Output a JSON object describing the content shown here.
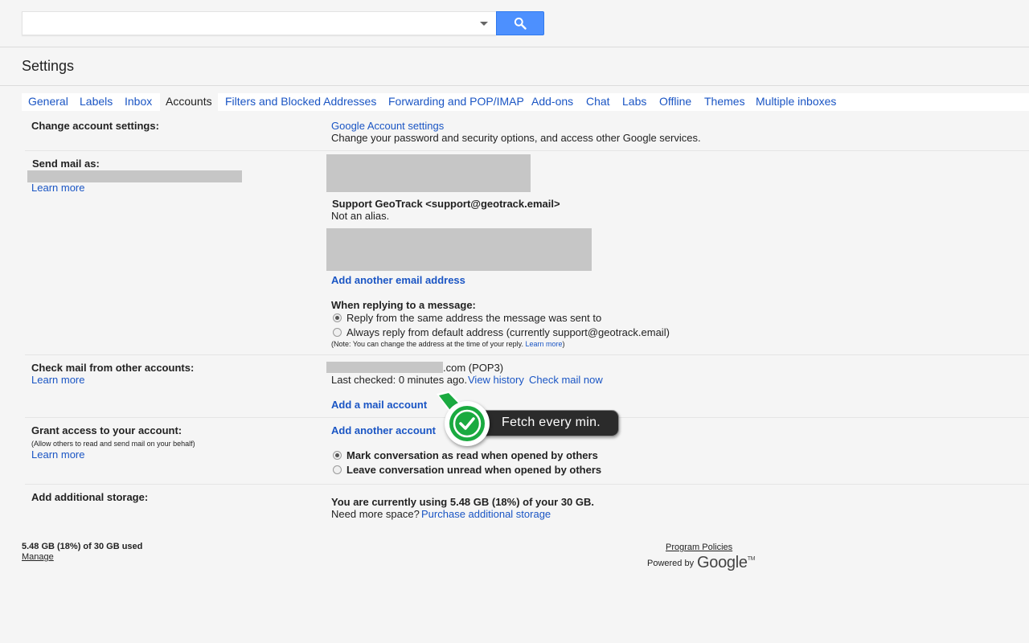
{
  "search": {
    "placeholder": "",
    "value": ""
  },
  "page_title": "Settings",
  "tabs": [
    {
      "label": "General"
    },
    {
      "label": "Labels"
    },
    {
      "label": "Inbox"
    },
    {
      "label": "Accounts"
    },
    {
      "label": "Filters and Blocked Addresses"
    },
    {
      "label": "Forwarding and POP/IMAP"
    },
    {
      "label": "Add-ons"
    },
    {
      "label": "Chat"
    },
    {
      "label": "Labs"
    },
    {
      "label": "Offline"
    },
    {
      "label": "Themes"
    },
    {
      "label": "Multiple inboxes"
    }
  ],
  "sections": {
    "change_account": {
      "label": "Change account settings:",
      "link": "Google Account settings",
      "description": "Change your password and security options, and access other Google services."
    },
    "send_mail": {
      "label": "Send mail as:",
      "learn_more": "Learn more",
      "account_name": "Support GeoTrack <support@geotrack.email>",
      "account_note": "Not an alias.",
      "add_address": "Add another email address",
      "reply_heading": "When replying to a message:",
      "reply_option_1": "Reply from the same address the message was sent to",
      "reply_option_2": "Always reply from default address (currently support@geotrack.email)",
      "reply_note": "(Note: You can change the address at the time of your reply.",
      "reply_note_link": "Learn more",
      "reply_note_end": ")"
    },
    "check_mail": {
      "label": "Check mail from other accounts:",
      "learn_more": "Learn more",
      "account_suffix": ".com (POP3)",
      "last_checked": "Last checked: 0 minutes ago.",
      "view_history": "View history",
      "check_now": "Check mail now",
      "add_account": "Add a mail account"
    },
    "grant_access": {
      "label": "Grant access to your account:",
      "sublabel": "(Allow others to read and send mail on your behalf)",
      "learn_more": "Learn more",
      "add_account": "Add another account",
      "option_1": "Mark conversation as read when opened by others",
      "option_2": "Leave conversation unread when opened by others"
    },
    "storage": {
      "label": "Add additional storage:",
      "usage_text": "You are currently using 5.48 GB (18%) of your 30 GB.",
      "need_more": "Need more space?",
      "purchase_link": "Purchase additional storage"
    }
  },
  "callout": {
    "text": "Fetch every min."
  },
  "footer": {
    "usage": "5.48 GB (18%) of 30 GB used",
    "manage": "Manage",
    "program_policies": "Program Policies",
    "powered_by": "Powered by",
    "google": "Google",
    "tm": "TM"
  },
  "colors": {
    "link": "#1a55c4",
    "search_button": "#4d90fe",
    "callout_green": "#1aaa40"
  }
}
